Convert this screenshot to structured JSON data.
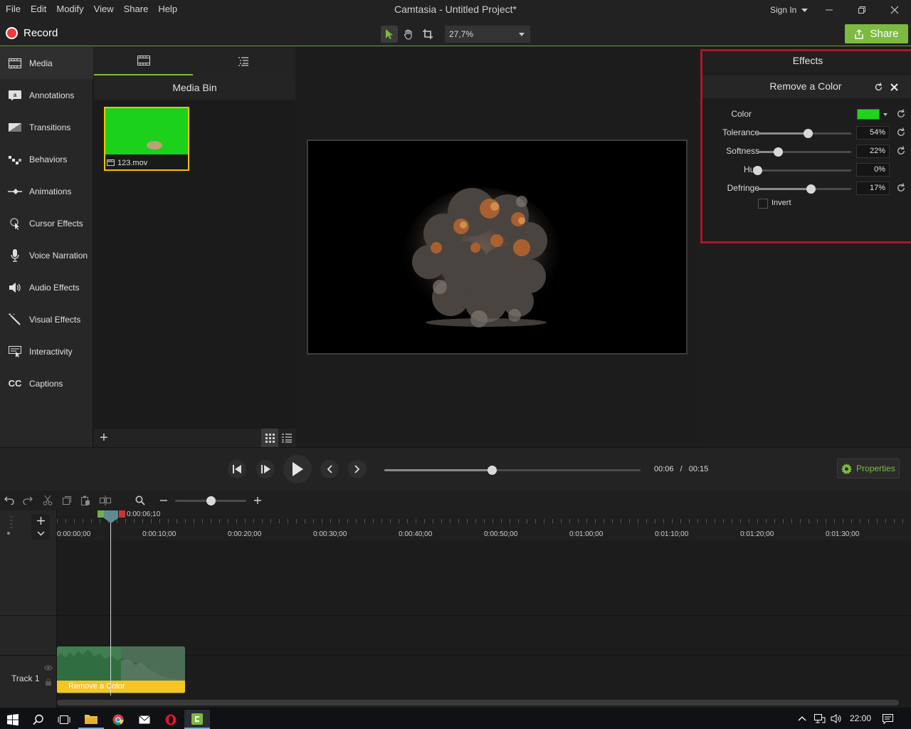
{
  "menu": {
    "items": [
      "File",
      "Edit",
      "Modify",
      "View",
      "Share",
      "Help"
    ]
  },
  "window": {
    "title": "Camtasia - Untitled Project*",
    "sign_in": "Sign In"
  },
  "toolbar": {
    "record_label": "Record",
    "zoom_value": "27,7%",
    "share_label": "Share"
  },
  "sidebar": {
    "items": [
      {
        "label": "Media",
        "icon": "filmstrip-icon"
      },
      {
        "label": "Annotations",
        "icon": "annotation-icon"
      },
      {
        "label": "Transitions",
        "icon": "transition-icon"
      },
      {
        "label": "Behaviors",
        "icon": "behaviors-icon"
      },
      {
        "label": "Animations",
        "icon": "animation-icon"
      },
      {
        "label": "Cursor Effects",
        "icon": "cursor-effects-icon"
      },
      {
        "label": "Voice Narration",
        "icon": "microphone-icon"
      },
      {
        "label": "Audio Effects",
        "icon": "speaker-icon"
      },
      {
        "label": "Visual Effects",
        "icon": "magic-wand-icon"
      },
      {
        "label": "Interactivity",
        "icon": "interactivity-icon"
      },
      {
        "label": "Captions",
        "icon": "captions-icon"
      }
    ]
  },
  "media_bin": {
    "title": "Media Bin",
    "clip_name": "123.mov"
  },
  "effects": {
    "title": "Effects",
    "effect_name": "Remove a Color",
    "color_label": "Color",
    "color_value": "#20d41e",
    "sliders": [
      {
        "label": "Tolerance",
        "value": "54%",
        "fraction": 0.54,
        "resettable": true
      },
      {
        "label": "Softness",
        "value": "22%",
        "fraction": 0.22,
        "resettable": true
      },
      {
        "label": "Hue",
        "value": "0%",
        "fraction": 0.0,
        "resettable": false
      },
      {
        "label": "Defringe",
        "value": "17%",
        "fraction": 0.57,
        "resettable": true
      }
    ],
    "invert_label": "Invert",
    "invert_checked": false
  },
  "playback": {
    "current_time": "00:06",
    "separator": "/",
    "total_time": "00:15",
    "progress": 0.42,
    "properties_label": "Properties"
  },
  "timeline": {
    "zoom_fraction": 0.5,
    "playhead_time": "0:00:06;10",
    "ticks": [
      "0:00:00;00",
      "0:00:10;00",
      "0:00:20;00",
      "0:00:30;00",
      "0:00:40;00",
      "0:00:50;00",
      "0:01:00;00",
      "0:01:10;00",
      "0:01:20;00",
      "0:01:30;00"
    ],
    "track_label": "Track 1",
    "clip_effect_label": "Remove a Color"
  },
  "taskbar": {
    "clock": "22:00"
  },
  "colors": {
    "accent_green": "#7dba42",
    "highlight_red": "#b0152a",
    "clip_yellow": "#f5c525",
    "chroma_green": "#1bd11b"
  }
}
